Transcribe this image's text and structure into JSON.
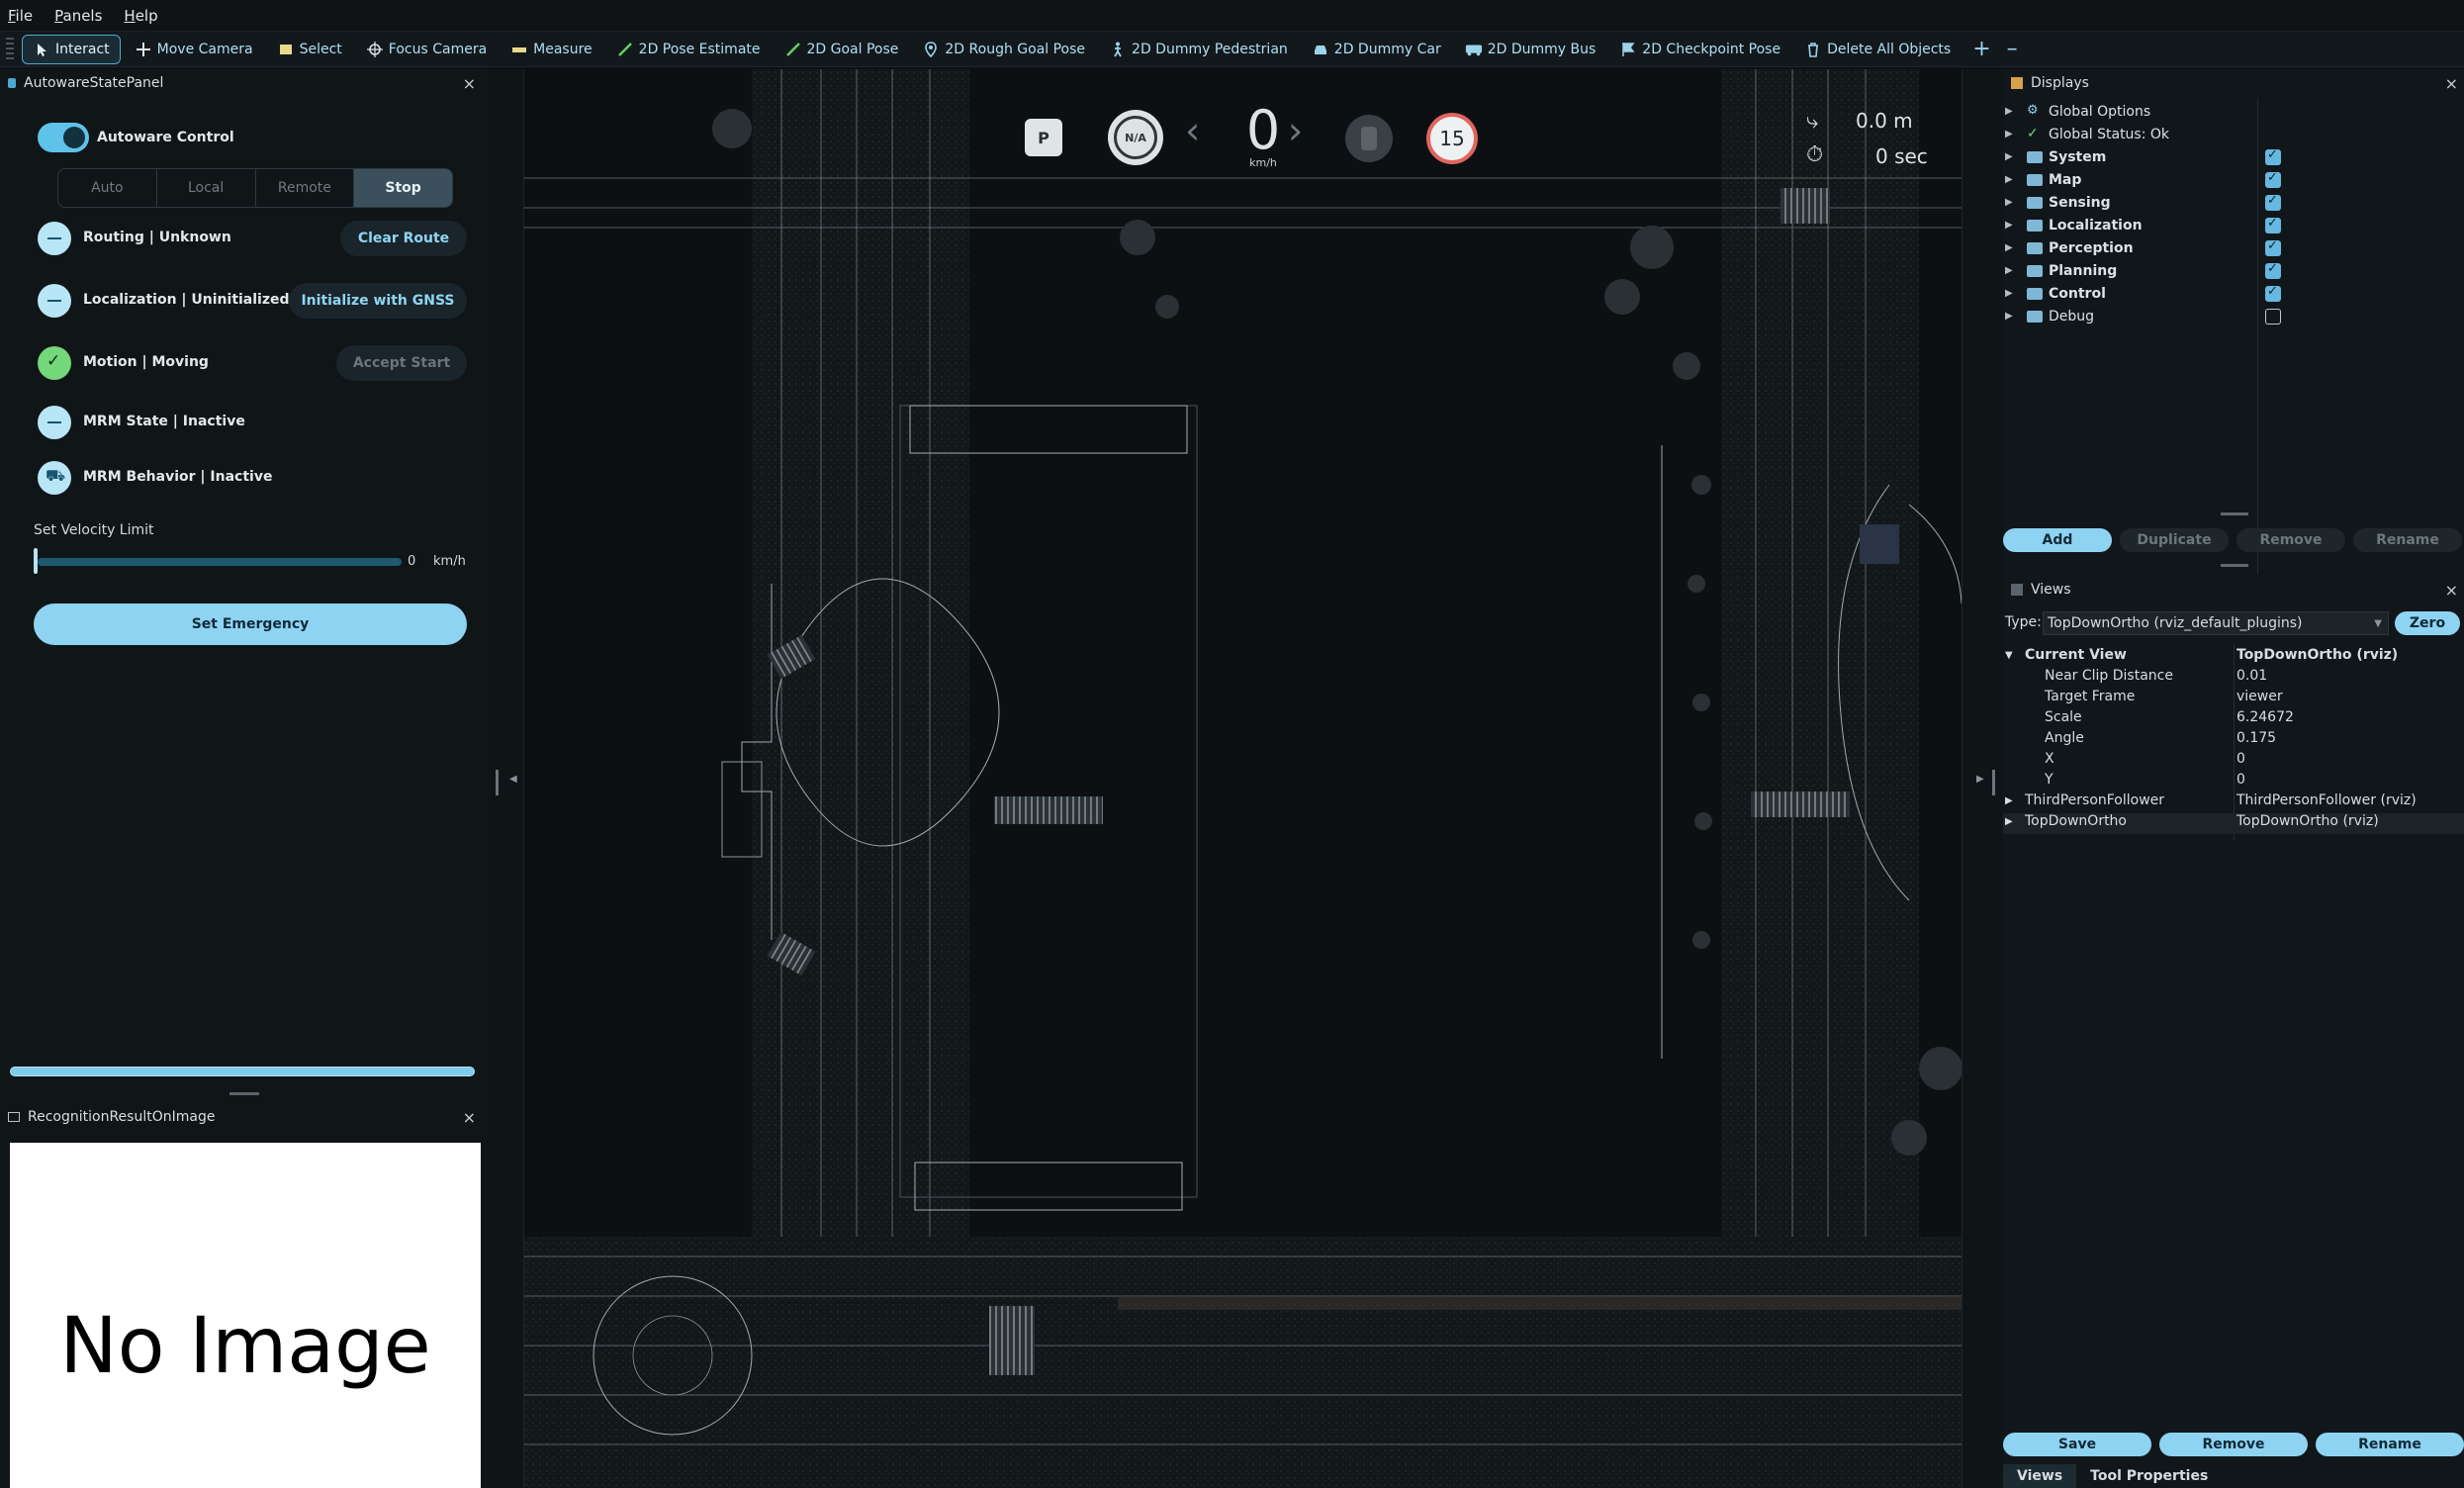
{
  "menubar": {
    "items": [
      "File",
      "Panels",
      "Help"
    ]
  },
  "toolbar": {
    "tools": [
      {
        "label": "Interact",
        "icon": "cursor-icon",
        "active": true
      },
      {
        "label": "Move Camera",
        "icon": "move-icon"
      },
      {
        "label": "Select",
        "icon": "select-icon"
      },
      {
        "label": "Focus Camera",
        "icon": "crosshair-icon"
      },
      {
        "label": "Measure",
        "icon": "ruler-icon"
      },
      {
        "label": "2D Pose Estimate",
        "icon": "arrow-green-icon"
      },
      {
        "label": "2D Goal Pose",
        "icon": "arrow-green-icon"
      },
      {
        "label": "2D Rough Goal Pose",
        "icon": "pin-icon"
      },
      {
        "label": "2D Dummy Pedestrian",
        "icon": "pedestrian-icon"
      },
      {
        "label": "2D Dummy Car",
        "icon": "car-icon"
      },
      {
        "label": "2D Dummy Bus",
        "icon": "bus-icon"
      },
      {
        "label": "2D Checkpoint Pose",
        "icon": "flag-icon"
      },
      {
        "label": "Delete All Objects",
        "icon": "trash-icon"
      }
    ],
    "add": "+",
    "remove": "–"
  },
  "state_panel": {
    "title": "AutowareStatePanel",
    "close": "×",
    "autoware_control_label": "Autoware Control",
    "modes": [
      "Auto",
      "Local",
      "Remote",
      "Stop"
    ],
    "selected_mode": "Stop",
    "routing": {
      "label": "Routing | Unknown",
      "button": "Clear Route"
    },
    "localization": {
      "label": "Localization | Uninitialized",
      "button": "Initialize with GNSS"
    },
    "motion": {
      "label": "Motion | Moving",
      "button": "Accept Start"
    },
    "mrm_state": {
      "label": "MRM State | Inactive"
    },
    "mrm_behavior": {
      "label": "MRM Behavior | Inactive"
    },
    "velocity_limit_label": "Set Velocity Limit",
    "velocity_value": "0",
    "velocity_unit": "km/h",
    "emergency_button": "Set Emergency"
  },
  "recognition_panel": {
    "title": "RecognitionResultOnImage",
    "close": "×",
    "placeholder": "No Image"
  },
  "hud": {
    "gear": "P",
    "steering": "N/A",
    "speed": "0",
    "speed_unit": "km/h",
    "speed_limit": "15",
    "distance": "0.0 m",
    "time": "0 sec"
  },
  "displays": {
    "title": "Displays",
    "close": "×",
    "items": [
      {
        "name": "Global Options",
        "kind": "gear",
        "checkbox": null,
        "bold": false
      },
      {
        "name": "Global Status: Ok",
        "kind": "check",
        "checkbox": null,
        "bold": false
      },
      {
        "name": "System",
        "kind": "folder",
        "checkbox": true,
        "bold": true
      },
      {
        "name": "Map",
        "kind": "folder",
        "checkbox": true,
        "bold": true
      },
      {
        "name": "Sensing",
        "kind": "folder",
        "checkbox": true,
        "bold": true
      },
      {
        "name": "Localization",
        "kind": "folder",
        "checkbox": true,
        "bold": true
      },
      {
        "name": "Perception",
        "kind": "folder",
        "checkbox": true,
        "bold": true
      },
      {
        "name": "Planning",
        "kind": "folder",
        "checkbox": true,
        "bold": true
      },
      {
        "name": "Control",
        "kind": "folder",
        "checkbox": true,
        "bold": true
      },
      {
        "name": "Debug",
        "kind": "folder",
        "checkbox": false,
        "bold": false
      }
    ],
    "buttons": [
      "Add",
      "Duplicate",
      "Remove",
      "Rename"
    ]
  },
  "views": {
    "title": "Views",
    "close": "×",
    "type_label": "Type:",
    "type_value": "TopDownOrtho (rviz_default_plugins)",
    "zero_button": "Zero",
    "current_view": {
      "key": "Current View",
      "value": "TopDownOrtho (rviz)"
    },
    "properties": [
      {
        "key": "Near Clip Distance",
        "value": "0.01"
      },
      {
        "key": "Target Frame",
        "value": "viewer"
      },
      {
        "key": "Scale",
        "value": "6.24672"
      },
      {
        "key": "Angle",
        "value": "0.175"
      },
      {
        "key": "X",
        "value": "0"
      },
      {
        "key": "Y",
        "value": "0"
      }
    ],
    "saved": [
      {
        "key": "ThirdPersonFollower",
        "value": "ThirdPersonFollower (rviz)"
      },
      {
        "key": "TopDownOrtho",
        "value": "TopDownOrtho (rviz)"
      }
    ],
    "buttons": [
      "Save",
      "Remove",
      "Rename"
    ]
  },
  "bottom_tabs": [
    "Views",
    "Tool Properties"
  ],
  "colors": {
    "accent": "#8fd3f2",
    "ok": "#74d779",
    "background": "#0d1114",
    "limit_ring": "#e0655f"
  }
}
